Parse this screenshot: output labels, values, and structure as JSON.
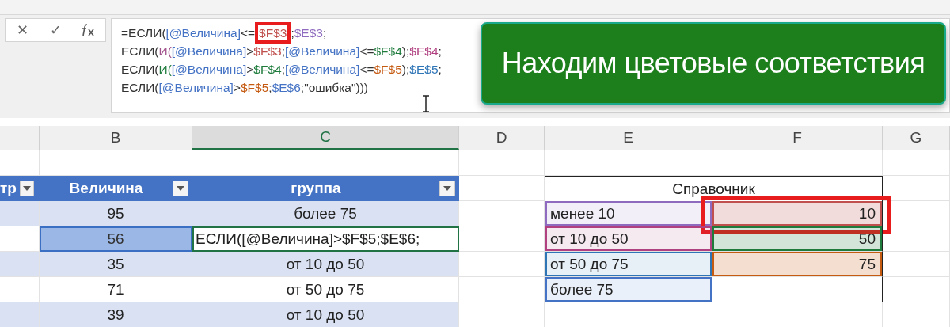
{
  "formula_bar": {
    "buttons": [
      "✕",
      "✓"
    ],
    "lines": [
      [
        {
          "text": "=ЕСЛИ("
        },
        {
          "text": "[@Величина]",
          "color": "#4472c4"
        },
        {
          "text": "<="
        },
        {
          "text": "$F$3",
          "color": "#c0504d",
          "highlighted": true
        },
        {
          "text": ";"
        },
        {
          "text": "$E$3",
          "color": "#8e6bbf"
        },
        {
          "text": ";"
        }
      ],
      [
        {
          "text": "ЕСЛИ("
        },
        {
          "text": "И(",
          "color": "#a0508a"
        },
        {
          "text": "[@Величина]",
          "color": "#4472c4"
        },
        {
          "text": ">"
        },
        {
          "text": "$F$3",
          "color": "#c0504d"
        },
        {
          "text": ";"
        },
        {
          "text": "[@Величина]",
          "color": "#4472c4"
        },
        {
          "text": "<="
        },
        {
          "text": "$F$4",
          "color": "#1e7b3c"
        },
        {
          "text": ");"
        },
        {
          "text": "$E$4",
          "color": "#b04080"
        },
        {
          "text": ";"
        }
      ],
      [
        {
          "text": "ЕСЛИ("
        },
        {
          "text": "И(",
          "color": "#1e7b3c"
        },
        {
          "text": "[@Величина]",
          "color": "#4472c4"
        },
        {
          "text": ">"
        },
        {
          "text": "$F$4",
          "color": "#1e7b3c"
        },
        {
          "text": ";"
        },
        {
          "text": "[@Величина]",
          "color": "#4472c4"
        },
        {
          "text": "<="
        },
        {
          "text": "$F$5",
          "color": "#c55a11"
        },
        {
          "text": ");"
        },
        {
          "text": "$E$5",
          "color": "#2e75b6"
        },
        {
          "text": ";"
        }
      ],
      [
        {
          "text": "ЕСЛИ("
        },
        {
          "text": "[@Величина]",
          "color": "#4472c4"
        },
        {
          "text": ">"
        },
        {
          "text": "$F$5",
          "color": "#c55a11"
        },
        {
          "text": ";"
        },
        {
          "text": "$E$6",
          "color": "#4472c4"
        },
        {
          "text": ";\"ошибка\")))"
        }
      ]
    ]
  },
  "banner": {
    "text": "Находим цветовые соответствия"
  },
  "column_headers": [
    "B",
    "C",
    "D",
    "E",
    "F",
    "G"
  ],
  "table": {
    "columns": [
      "тр",
      "Величина",
      "группа"
    ],
    "rows": [
      {
        "value": "95",
        "group": "более 75",
        "selected": false,
        "editing": false
      },
      {
        "value": "56",
        "group": "ЕСЛИ([@Величина]>$F$5;$E$6;",
        "selected": true,
        "editing": true
      },
      {
        "value": "35",
        "group": "от 10 до 50",
        "selected": false,
        "editing": false
      },
      {
        "value": "71",
        "group": "от 50 до 75",
        "selected": false,
        "editing": false
      },
      {
        "value": "39",
        "group": "от 10 до 50",
        "selected": false,
        "editing": false
      }
    ]
  },
  "reference": {
    "title": "Справочник",
    "rows": [
      {
        "label": {
          "text": "менее 10",
          "color": "#8e6bbf"
        },
        "value": {
          "text": "10",
          "color": "#c0504d",
          "highlighted": true
        }
      },
      {
        "label": {
          "text": "от 10 до 50",
          "color": "#b04080"
        },
        "value": {
          "text": "50",
          "color": "#1e7b3c",
          "highlighted": false
        }
      },
      {
        "label": {
          "text": "от 50 до 75",
          "color": "#2e75b6"
        },
        "value": {
          "text": "75",
          "color": "#c55a11",
          "highlighted": false
        }
      },
      {
        "label": {
          "text": "более 75",
          "color": "#4472c4"
        }
      }
    ]
  }
}
